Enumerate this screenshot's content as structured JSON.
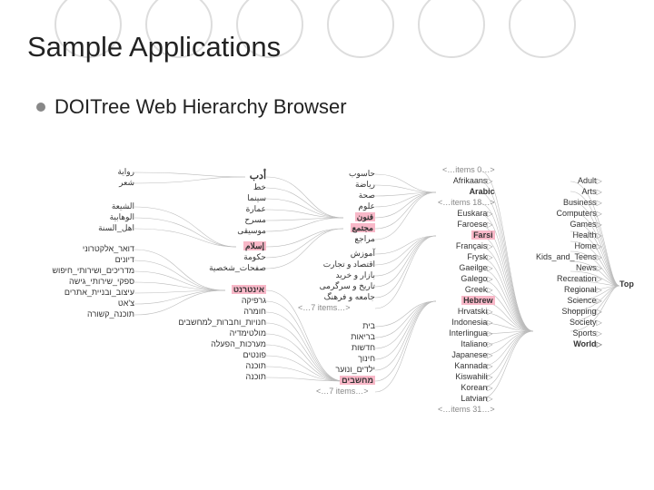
{
  "slide": {
    "title": "Sample Applications",
    "subtitle": "DOITree Web Hierarchy Browser"
  },
  "root": {
    "label": "Top"
  },
  "topics": {
    "items": [
      "Adult",
      "Arts",
      "Business",
      "Computers",
      "Games",
      "Health",
      "Home",
      "Kids_and_Teens",
      "News",
      "Recreation",
      "Regional",
      "Science",
      "Shopping",
      "Society",
      "Sports",
      "World"
    ]
  },
  "languages": {
    "more_top": "<…0 items…>",
    "items_top": [
      "Afrikaans"
    ],
    "arabic": "Arabic",
    "more_18": "<…18 items…>",
    "items_mid": [
      "Euskara",
      "Faroese"
    ],
    "farsi": "Farsi",
    "items_mid2": [
      "Français",
      "Frysk",
      "Gaeilge",
      "Galego",
      "Greek"
    ],
    "hebrew": "Hebrew",
    "items_bot": [
      "Hrvatski",
      "Indonesia",
      "Interlingua",
      "Italiano",
      "Japanese",
      "Kannada",
      "Kiswahili",
      "Korean",
      "Latvian"
    ],
    "more_bot": "<…31 items…>"
  },
  "arabic_children": {
    "items": [
      "حاسوب",
      "رياضة",
      "صحة",
      "علوم"
    ],
    "arts": "فنون",
    "society": "مجتمع",
    "items2": [
      "مراجع"
    ]
  },
  "farsi_children": {
    "items": [
      "آموزش",
      "اقتصاد و تجارت",
      "بازار و خرید",
      "تاریخ و سرگرمی",
      "جامعه و فرهنگ"
    ],
    "more": "<…7 items…>"
  },
  "hebrew_children": {
    "items": [
      "בית",
      "בריאות",
      "חדשות",
      "חינוך",
      "ילדים_ונוער"
    ],
    "computers": "מחשבים",
    "more": "<…7 items…>"
  },
  "arabic_arts": {
    "items": [
      "أدب",
      "خط",
      "سينما",
      "عمارة",
      "مسرح",
      "موسيقى"
    ]
  },
  "arabic_society": {
    "islam": "إسلام",
    "items": [
      "حكومة",
      "صفحات_شخصية"
    ]
  },
  "hebrew_computers": {
    "internet": "אינטרנט",
    "items": [
      "גרפיקה",
      "חומרה",
      "חנויות_וחברות_למחשבים",
      "מולטימדיה",
      "מערכות_הפעלה",
      "פונטים",
      "תוכנה",
      "תוכנה"
    ]
  },
  "arabic_lit": {
    "items": [
      "رواية",
      "شعر"
    ]
  },
  "arabic_islam": {
    "items": [
      "الشيعة",
      "الوهابية",
      "اهل_السنة"
    ]
  },
  "hebrew_internet": {
    "items": [
      "דואר_אלקטרוני",
      "דיונים",
      "מדריכים_ושירותי_חיפוש",
      "ספקי_שירותי_גישה",
      "עיצוב_ובניית_אתרים",
      "צ'אט",
      "תוכנה_קשורה"
    ]
  }
}
